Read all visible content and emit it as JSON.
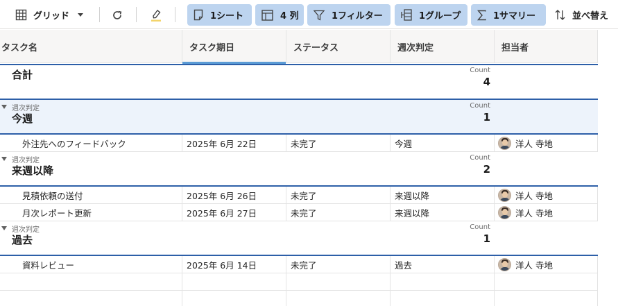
{
  "toolbar": {
    "view_label": "グリッド",
    "sheet_label": "1シート",
    "columns_label": "4 列",
    "filter_label": "1フィルター",
    "group_label": "1グループ",
    "summary_label": "1サマリー",
    "sort_label": "並べ替え"
  },
  "columns": [
    {
      "label": "タスク名"
    },
    {
      "label": "タスク期日"
    },
    {
      "label": "ステータス"
    },
    {
      "label": "週次判定"
    },
    {
      "label": "担当者"
    }
  ],
  "total": {
    "title": "合計",
    "count_label": "Count",
    "count": "4"
  },
  "groups": [
    {
      "caption": "週次判定",
      "title": "今週",
      "count_label": "Count",
      "count": "1",
      "rows": [
        {
          "task": "外注先へのフィードバック",
          "due": "2025年 6月 22日",
          "status": "未完了",
          "week": "今週",
          "owner": "洋人 寺地"
        }
      ]
    },
    {
      "caption": "週次判定",
      "title": "来週以降",
      "count_label": "Count",
      "count": "2",
      "rows": [
        {
          "task": "見積依頼の送付",
          "due": "2025年 6月 26日",
          "status": "未完了",
          "week": "来週以降",
          "owner": "洋人 寺地"
        },
        {
          "task": "月次レポート更新",
          "due": "2025年 6月 27日",
          "status": "未完了",
          "week": "来週以降",
          "owner": "洋人 寺地"
        }
      ]
    },
    {
      "caption": "週次判定",
      "title": "過去",
      "count_label": "Count",
      "count": "1",
      "rows": [
        {
          "task": "資料レビュー",
          "due": "2025年 6月 14日",
          "status": "未完了",
          "week": "過去",
          "owner": "洋人 寺地"
        }
      ]
    }
  ],
  "colors": {
    "accent_pill": "#bdd4ef",
    "group_line": "#2d5fa8",
    "selected_band": "#edf3fb"
  },
  "icons": [
    "grid-icon",
    "dropdown-caret-icon",
    "refresh-icon",
    "highlighter-icon",
    "sheet-icon",
    "columns-icon",
    "filter-icon",
    "group-icon",
    "summary-icon",
    "sort-icon",
    "collapse-triangle-icon",
    "avatar-icon"
  ]
}
